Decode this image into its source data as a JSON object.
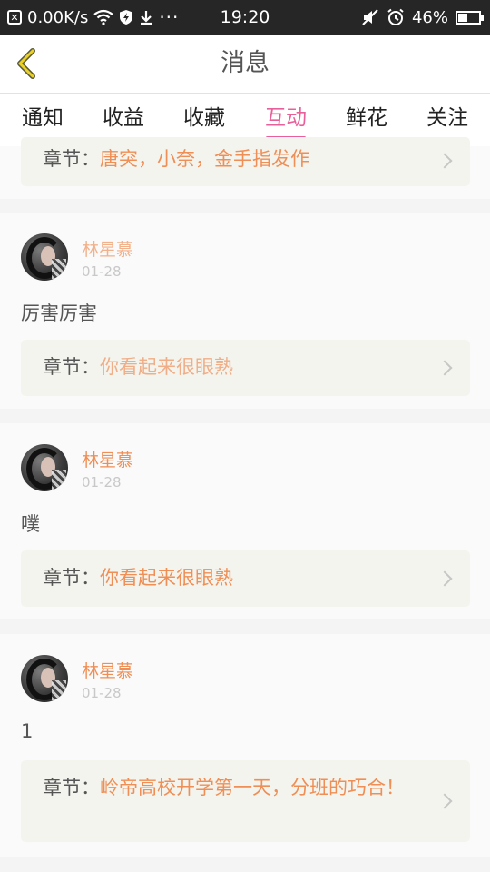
{
  "status_bar": {
    "network_speed": "0.00K/s",
    "time": "19:20",
    "battery": "46%",
    "battery_level": 0.46,
    "icons": [
      "close-box-icon",
      "wifi-icon",
      "shield-icon",
      "download-icon",
      "more-dots-icon",
      "mute-icon",
      "alarm-icon",
      "battery-icon"
    ]
  },
  "header": {
    "title": "消息"
  },
  "tabs": [
    "通知",
    "收益",
    "收藏",
    "互动",
    "鲜花",
    "关注"
  ],
  "active_tab": "互动",
  "chapter_label": "章节：",
  "messages": [
    {
      "chapter": "唐突，小奈，金手指发作"
    },
    {
      "user": "林星慕",
      "date": "01-28",
      "text": "厉害厉害",
      "chapter": "你看起来很眼熟"
    },
    {
      "user": "林星慕",
      "date": "01-28",
      "text": "噗",
      "chapter": "你看起来很眼熟"
    },
    {
      "user": "林星慕",
      "date": "01-28",
      "text": "1",
      "chapter": "岭帝高校开学第一天，分班的巧合！"
    }
  ],
  "colors": {
    "accent_pink": "#e8609b",
    "chapter_orange": "#ef8e55",
    "header_bar": "#262626"
  }
}
